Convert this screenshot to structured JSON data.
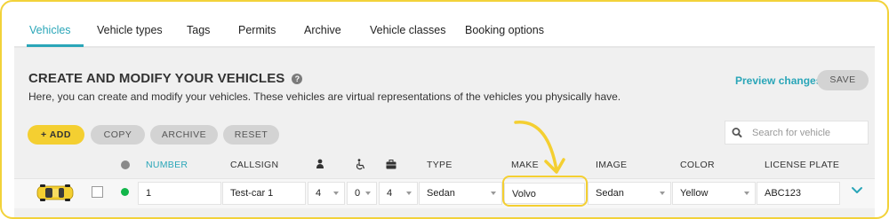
{
  "tabs": [
    {
      "label": "Vehicles",
      "active": true
    },
    {
      "label": "Vehicle types"
    },
    {
      "label": "Tags"
    },
    {
      "label": "Permits"
    },
    {
      "label": "Archive"
    },
    {
      "label": "Vehicle classes"
    },
    {
      "label": "Booking options"
    }
  ],
  "header": {
    "title": "CREATE AND MODIFY YOUR VEHICLES",
    "help": "?",
    "subtitle": "Here, you can create and modify your vehicles. These vehicles are virtual representations of the vehicles you physically have.",
    "preview_label": "Preview changes",
    "save_label": "SAVE"
  },
  "toolbar": {
    "add_label": "+ ADD",
    "copy_label": "COPY",
    "archive_label": "ARCHIVE",
    "reset_label": "RESET"
  },
  "search": {
    "placeholder": "Search for vehicle",
    "value": ""
  },
  "table": {
    "columns": {
      "number": "NUMBER",
      "callsign": "CALLSIGN",
      "seats_icon": "person-icon",
      "wheelchair_icon": "wheelchair-icon",
      "luggage_icon": "briefcase-icon",
      "type": "TYPE",
      "make": "MAKE",
      "image": "IMAGE",
      "color": "COLOR",
      "license_plate": "LICENSE PLATE"
    },
    "rows": [
      {
        "number": "1",
        "callsign": "Test-car 1",
        "seats": "4",
        "wheelchairs": "0",
        "luggage": "4",
        "type": "Sedan",
        "make": "Volvo",
        "image": "Sedan",
        "color": "Yellow",
        "license_plate": "ABC123",
        "status_color": "#12b64a"
      }
    ]
  },
  "colors": {
    "accent": "#2aa6b8",
    "highlight": "#f4cf31",
    "status_active": "#12b64a"
  }
}
